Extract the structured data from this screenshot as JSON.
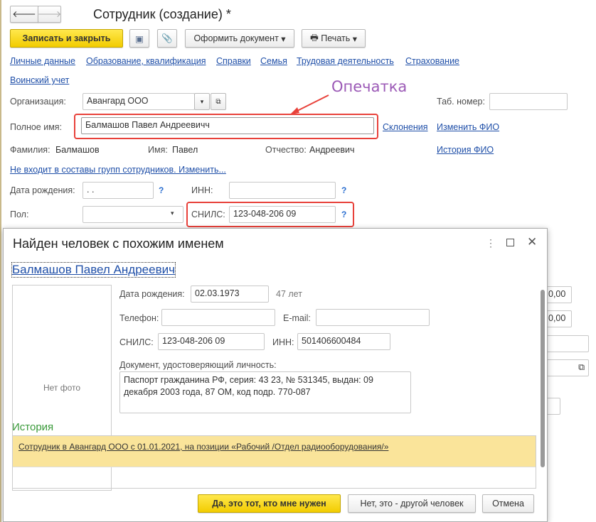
{
  "window": {
    "title": "Сотрудник (создание) *"
  },
  "toolbar": {
    "save_close": "Записать и закрыть",
    "make_doc": "Оформить документ",
    "print": "Печать"
  },
  "tabs": [
    "Личные данные",
    "Образование, квалификация",
    "Справки",
    "Семья",
    "Трудовая деятельность",
    "Страхование",
    "Воинский учет"
  ],
  "annotation": "Опечатка",
  "form": {
    "org_label": "Организация:",
    "org_value": "Авангард ООО",
    "tab_label": "Таб. номер:",
    "fullname_label": "Полное имя:",
    "fullname_value": "Балмашов Павел Андреевичч",
    "declension": "Склонения",
    "change_fio": "Изменить ФИО",
    "history_fio": "История ФИО",
    "surname_label": "Фамилия:",
    "surname": "Балмашов",
    "name_label": "Имя:",
    "name": "Павел",
    "patronymic_label": "Отчество:",
    "patronymic": "Андреевич",
    "groups_link": "Не входит в составы групп сотрудников. Изменить...",
    "birth_label": "Дата рождения:",
    "birth_value": " .  .",
    "inn_label": "ИНН:",
    "gender_label": "Пол:",
    "snils_label": "СНИЛС:",
    "snils_value": "123-048-206 09",
    "help": "?",
    "bg_values": [
      "0,00",
      "0,00"
    ]
  },
  "dialog": {
    "title": "Найден человек с похожим именем",
    "person": "Балмашов Павел Андреевич",
    "no_photo": "Нет фото",
    "birth_label": "Дата рождения:",
    "birth": "02.03.1973",
    "age": "47 лет",
    "phone_label": "Телефон:",
    "email_label": "E-mail:",
    "snils_label": "СНИЛС:",
    "snils": "123-048-206 09",
    "inn_label": "ИНН:",
    "inn": "501406600484",
    "doc_label": "Документ, удостоверяющий личность:",
    "doc": "Паспорт гражданина РФ, серия: 43 23, № 531345, выдан: 09 декабря 2003 года, 87 ОМ, код подр. 770-087",
    "history_title": "История",
    "history_item": "Сотрудник в Авангард ООО с 01.01.2021, на позиции «Рабочий /Отдел радиооборудования/»",
    "yes": "Да, это тот, кто мне нужен",
    "no": "Нет, это - другой человек",
    "cancel": "Отмена"
  }
}
